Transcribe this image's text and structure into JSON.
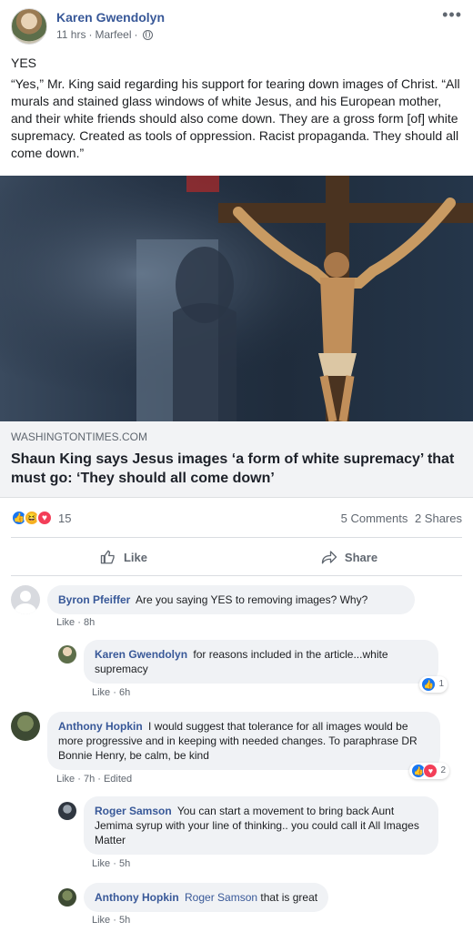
{
  "post": {
    "author": "Karen Gwendolyn",
    "time": "11 hrs",
    "location": "Marfeel",
    "separator": "·",
    "text": [
      "YES",
      "“Yes,” Mr. King said regarding his support for tearing down images of Christ. “All murals and stained glass windows of white Jesus, and his European mother, and their white friends should also come down. They are a gross form [of] white supremacy. Created as tools of oppression. Racist propaganda. They should all come down.”"
    ]
  },
  "link": {
    "domain": "WASHINGTONTIMES.COM",
    "headline": "Shaun King says Jesus images ‘a form of white supremacy’ that must go: ‘They should all come down’",
    "image_desc_icon": "crucifix-photo"
  },
  "stats": {
    "reaction_count": "15",
    "comments": "5 Comments",
    "shares": "2 Shares"
  },
  "actions": {
    "like": "Like",
    "share": "Share"
  },
  "comments": [
    {
      "name": "Byron Pfeiffer",
      "text": "Are you saying YES to removing images? Why?",
      "meta": "Like · 8h"
    },
    {
      "name": "Karen Gwendolyn",
      "text": "for reasons included in the article...white supremacy",
      "meta": "Like · 6h",
      "reactions": "1"
    },
    {
      "name": "Anthony Hopkin",
      "text": "I would suggest that tolerance for all images would be more progressive and in keeping with needed changes. To paraphrase DR Bonnie Henry, be calm, be kind",
      "meta": "Like · 7h · Edited",
      "reactions": "2"
    },
    {
      "name": "Roger Samson",
      "text": "You can start a movement to bring back Aunt Jemima syrup with your line of thinking.. you could call it All Images Matter",
      "meta": "Like · 5h"
    },
    {
      "name": "Anthony Hopkin",
      "mention": "Roger Samson",
      "text": "that is great",
      "meta": "Like · 5h"
    }
  ],
  "colors": {
    "link_blue": "#385898",
    "like_blue": "#1877f2",
    "love_red": "#f33e58",
    "haha_yellow": "#f7b125"
  }
}
